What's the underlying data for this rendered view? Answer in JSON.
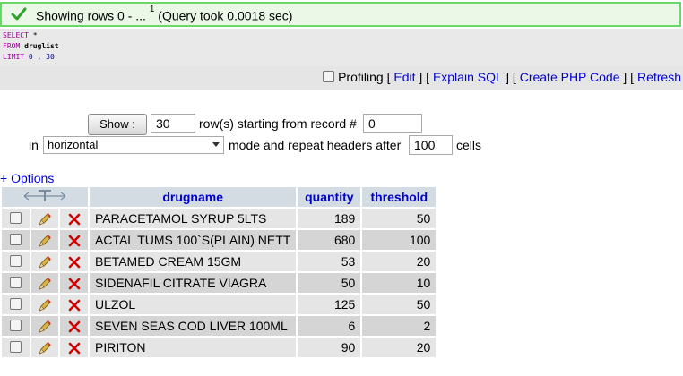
{
  "status": {
    "message": "Showing rows 0 - ... ",
    "superscript": "1",
    "query_time": " (Query took 0.0018 sec)",
    "icon": "checkmark-icon"
  },
  "sql": {
    "line1_kw": "SELECT",
    "line1_rest": " *",
    "line2_kw": "FROM",
    "line2_rest": " druglist",
    "line3_kw": "LIMIT",
    "line3_rest": " 0 , 30"
  },
  "tools": {
    "profiling": "Profiling",
    "edit": "Edit",
    "explain": "Explain SQL",
    "create_php": "Create PHP Code",
    "refresh": "Refresh"
  },
  "navigation": {
    "show_button": "Show :",
    "rows_value": "30",
    "rows_label": "row(s) starting from record #",
    "start_value": "0",
    "in_label": "in",
    "mode_selected": "horizontal",
    "mode_label": "mode and repeat headers after",
    "repeat_value": "100",
    "cells_label": "cells"
  },
  "options_link": "+ Options",
  "table": {
    "columns": [
      "drugname",
      "quantity",
      "threshold"
    ],
    "rows": [
      {
        "drugname": "PARACETAMOL SYRUP 5LTS",
        "quantity": "189",
        "threshold": "50"
      },
      {
        "drugname": "ACTAL TUMS 100`S(PLAIN) NETT",
        "quantity": "680",
        "threshold": "100"
      },
      {
        "drugname": "BETAMED CREAM 15GM",
        "quantity": "53",
        "threshold": "20"
      },
      {
        "drugname": "SIDENAFIL CITRATE VIAGRA",
        "quantity": "50",
        "threshold": "10"
      },
      {
        "drugname": "ULZOL",
        "quantity": "125",
        "threshold": "50"
      },
      {
        "drugname": "SEVEN SEAS COD LIVER 100ML",
        "quantity": "6",
        "threshold": "2"
      },
      {
        "drugname": "PIRITON",
        "quantity": "90",
        "threshold": "20"
      }
    ]
  },
  "colors": {
    "link": "#0000cc",
    "success_border": "#66d966",
    "header_bg": "#d3dce3",
    "delete_red": "#cc0000"
  }
}
